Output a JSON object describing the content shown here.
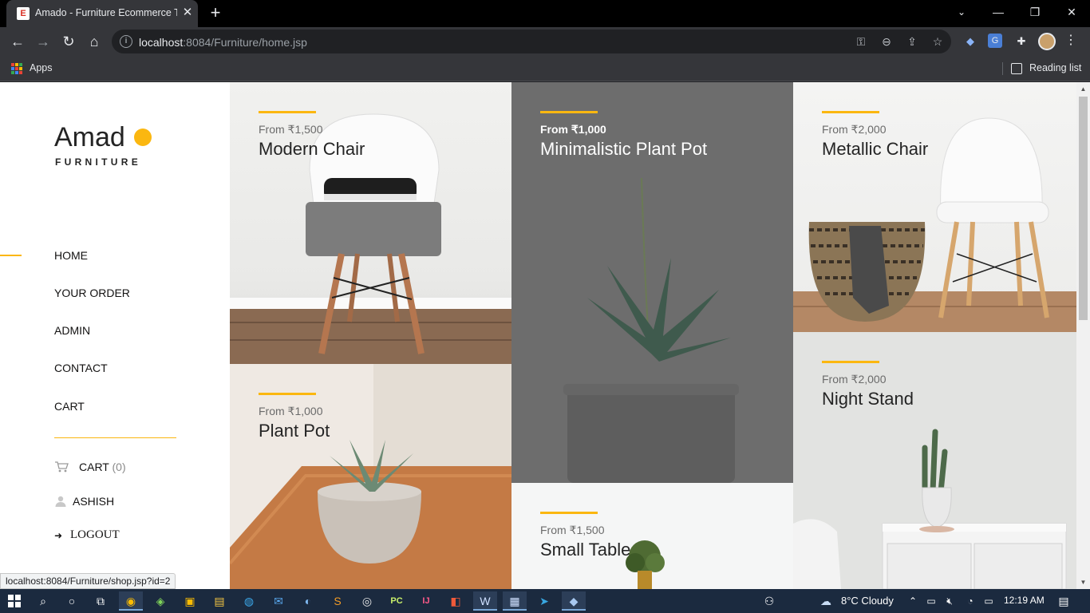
{
  "browser": {
    "tab_title": "Amado - Furniture Ecommerce Te",
    "favicon_letter": "E",
    "url_host": "localhost",
    "url_path": ":8084/Furniture/home.jsp",
    "bookmarks": {
      "apps": "Apps",
      "reading_list": "Reading list"
    },
    "status_url": "localhost:8084/Furniture/shop.jsp?id=2"
  },
  "site": {
    "logo": {
      "word": "Amad",
      "subtitle": "FURNITURE"
    },
    "nav": [
      "HOME",
      "YOUR ORDER",
      "ADMIN",
      "CONTACT",
      "CART"
    ],
    "cart": {
      "label": "CART",
      "count": "(0)"
    },
    "user": {
      "name": "ASHISH"
    },
    "logout": "LOGOUT",
    "accent_color": "#fbb710"
  },
  "products": [
    {
      "price": "From ₹1,500",
      "name": "Modern Chair"
    },
    {
      "price": "From ₹1,000",
      "name": "Minimalistic Plant Pot"
    },
    {
      "price": "From ₹2,000",
      "name": "Metallic Chair"
    },
    {
      "price": "From ₹1,000",
      "name": "Plant Pot"
    },
    {
      "price": "From ₹1,500",
      "name": "Small Table"
    },
    {
      "price": "From ₹2,000",
      "name": "Night Stand"
    }
  ],
  "taskbar": {
    "weather": "8°C  Cloudy",
    "time": "12:19 AM"
  }
}
